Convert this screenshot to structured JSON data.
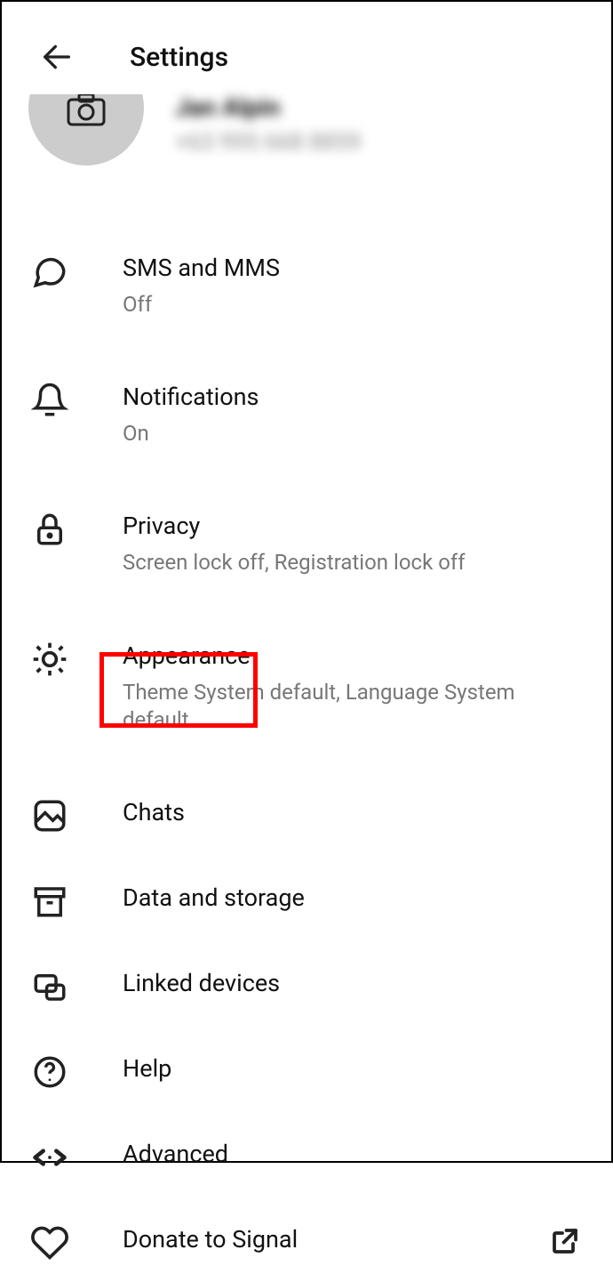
{
  "header": {
    "title": "Settings"
  },
  "profile": {
    "name": "Jan Alpin",
    "phone": "+63 995 668 8859"
  },
  "menu": {
    "sms": {
      "label": "SMS and MMS",
      "sub": "Off"
    },
    "notifications": {
      "label": "Notifications",
      "sub": "On"
    },
    "privacy": {
      "label": "Privacy",
      "sub": "Screen lock off, Registration lock off"
    },
    "appearance": {
      "label": "Appearance",
      "sub": "Theme System default, Language System default"
    },
    "chats": {
      "label": "Chats"
    },
    "data": {
      "label": "Data and storage"
    },
    "linked": {
      "label": "Linked devices"
    },
    "help": {
      "label": "Help"
    },
    "advanced": {
      "label": "Advanced"
    },
    "donate": {
      "label": "Donate to Signal"
    }
  }
}
